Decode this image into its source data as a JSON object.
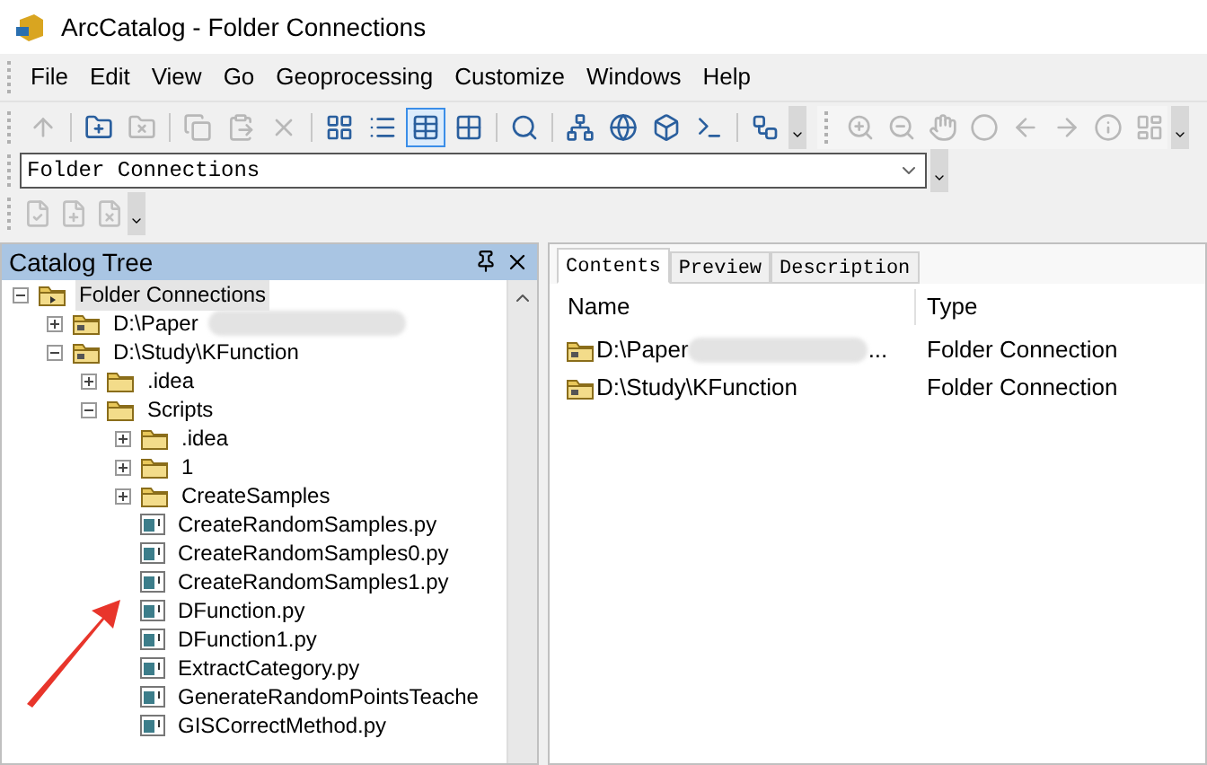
{
  "window": {
    "title": "ArcCatalog - Folder Connections"
  },
  "menu": [
    "File",
    "Edit",
    "View",
    "Go",
    "Geoprocessing",
    "Customize",
    "Windows",
    "Help"
  ],
  "toolbar": [
    {
      "disabled": true,
      "selected": false
    },
    {
      "disabled": false,
      "selected": false
    },
    {
      "disabled": true,
      "selected": false
    },
    {
      "disabled": true,
      "selected": false
    },
    {
      "disabled": true,
      "selected": false
    },
    {
      "disabled": true,
      "selected": false
    },
    {
      "disabled": false,
      "selected": false
    },
    {
      "disabled": false,
      "selected": false
    },
    {
      "disabled": false,
      "selected": true
    },
    {
      "disabled": false,
      "selected": false
    },
    {
      "disabled": false,
      "selected": false
    },
    {
      "disabled": false,
      "selected": false
    },
    {
      "disabled": false,
      "selected": false
    },
    {
      "disabled": false,
      "selected": false
    },
    {
      "disabled": false,
      "selected": false
    },
    {
      "disabled": false,
      "selected": false
    }
  ],
  "toolbar2": [
    {
      "disabled": true
    },
    {
      "disabled": true
    },
    {
      "disabled": true
    },
    {
      "disabled": true
    },
    {
      "disabled": true
    },
    {
      "disabled": true
    },
    {
      "disabled": true
    },
    {
      "disabled": true
    }
  ],
  "location": {
    "value": "Folder Connections"
  },
  "catalog_tree": {
    "title": "Catalog Tree",
    "items": [
      {
        "label": "Folder Connections",
        "kind": "root",
        "expanded": true,
        "selected": true,
        "children": [
          {
            "label": "D:\\Paper",
            "kind": "connection",
            "expanded": false,
            "selected": false,
            "blurred": true
          },
          {
            "label": "D:\\Study\\KFunction",
            "kind": "connection",
            "expanded": true,
            "selected": false,
            "children": [
              {
                "label": ".idea",
                "kind": "folder",
                "expanded": false,
                "selected": false
              },
              {
                "label": "Scripts",
                "kind": "folder",
                "expanded": true,
                "selected": false,
                "children": [
                  {
                    "label": ".idea",
                    "kind": "folder",
                    "expanded": false,
                    "selected": false
                  },
                  {
                    "label": "1",
                    "kind": "folder",
                    "expanded": false,
                    "selected": false
                  },
                  {
                    "label": "CreateSamples",
                    "kind": "folder",
                    "expanded": false,
                    "selected": false
                  },
                  {
                    "label": "CreateRandomSamples.py",
                    "kind": "script",
                    "selected": false
                  },
                  {
                    "label": "CreateRandomSamples0.py",
                    "kind": "script",
                    "selected": false
                  },
                  {
                    "label": "CreateRandomSamples1.py",
                    "kind": "script",
                    "selected": false
                  },
                  {
                    "label": "DFunction.py",
                    "kind": "script",
                    "selected": false
                  },
                  {
                    "label": "DFunction1.py",
                    "kind": "script",
                    "selected": false
                  },
                  {
                    "label": "ExtractCategory.py",
                    "kind": "script",
                    "selected": false
                  },
                  {
                    "label": "GenerateRandomPointsTeache",
                    "kind": "script",
                    "selected": false
                  },
                  {
                    "label": "GISCorrectMethod.py",
                    "kind": "script",
                    "selected": false
                  }
                ]
              }
            ]
          }
        ]
      }
    ]
  },
  "tabs": [
    {
      "label": "Contents",
      "selected": true
    },
    {
      "label": "Preview",
      "selected": false
    },
    {
      "label": "Description",
      "selected": false
    }
  ],
  "contents": {
    "columns": [
      "Name",
      "Type"
    ],
    "rows": [
      {
        "name": "D:\\Paper",
        "blurred": true,
        "suffix": "...",
        "type": "Folder Connection"
      },
      {
        "name": "D:\\Study\\KFunction",
        "type": "Folder Connection"
      }
    ]
  }
}
